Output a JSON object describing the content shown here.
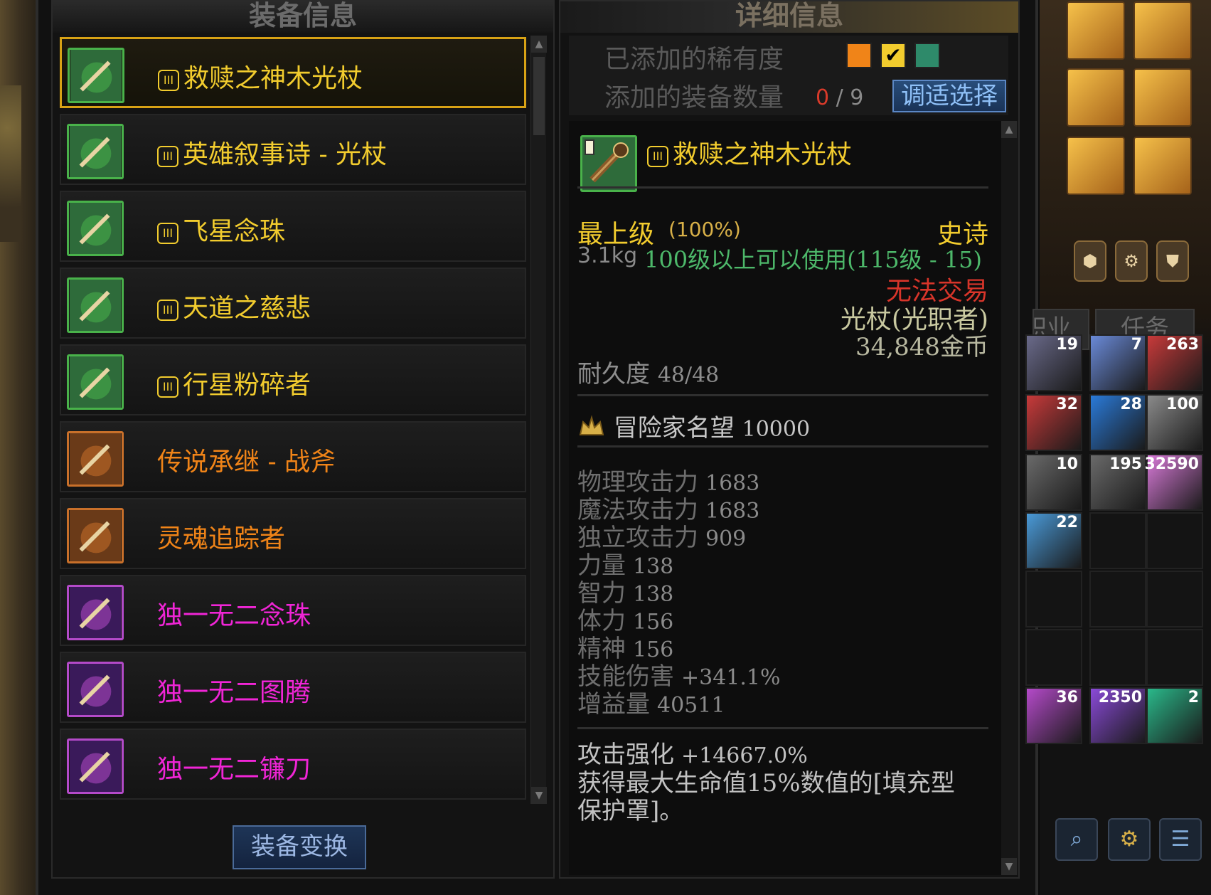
{
  "left_panel": {
    "title": "装备信息",
    "items": [
      {
        "name": "救赎之神木光杖",
        "grade": "epic",
        "roman": "III",
        "selected": true,
        "icon": "staff-icon"
      },
      {
        "name": "英雄叙事诗 - 光杖",
        "grade": "epic",
        "roman": "III",
        "selected": false,
        "icon": "staff-icon"
      },
      {
        "name": "飞星念珠",
        "grade": "epic",
        "roman": "III",
        "selected": false,
        "icon": "rosary-icon"
      },
      {
        "name": "天道之慈悲",
        "grade": "epic",
        "roman": "III",
        "selected": false,
        "icon": "gauntlet-icon"
      },
      {
        "name": "行星粉碎者",
        "grade": "epic",
        "roman": "III",
        "selected": false,
        "icon": "tonfa-icon"
      },
      {
        "name": "传说承继 - 战斧",
        "grade": "legend",
        "roman": "",
        "selected": false,
        "icon": "axe-icon"
      },
      {
        "name": "灵魂追踪者",
        "grade": "legend",
        "roman": "",
        "selected": false,
        "icon": "scythe-icon"
      },
      {
        "name": "独一无二念珠",
        "grade": "unique",
        "roman": "",
        "selected": false,
        "icon": "rosary-icon"
      },
      {
        "name": "独一无二图腾",
        "grade": "unique",
        "roman": "",
        "selected": false,
        "icon": "totem-icon"
      },
      {
        "name": "独一无二镰刀",
        "grade": "unique",
        "roman": "",
        "selected": false,
        "icon": "scythe-icon"
      }
    ],
    "swap_button": "装备变换"
  },
  "right_panel": {
    "title": "详细信息",
    "rarity_label": "已添加的稀有度",
    "count_label": "添加的装备数量",
    "count_current": "0",
    "count_sep": "/",
    "count_max": "9",
    "adjust_button": "调适选择",
    "colors": {
      "legend": "#f08418",
      "epic": "#f2cc2e",
      "unique": "#f025d6",
      "rare_green": "#2e8a6a"
    }
  },
  "detail": {
    "roman": "III",
    "name": "救赎之神木光杖",
    "grade": "最上级",
    "grade_pct": "(100%)",
    "rarity": "史诗",
    "weight": "3.1kg",
    "level_req": "100级以上可以使用(115级 - 15)",
    "trade": "无法交易",
    "type": "光杖(光职者)",
    "price": "34,848金币",
    "durability_label": "耐久度",
    "durability_value": "48/48",
    "fame_label": "冒险家名望",
    "fame_value": "10000",
    "stats": [
      {
        "label": "物理攻击力",
        "value": "1683"
      },
      {
        "label": "魔法攻击力",
        "value": "1683"
      },
      {
        "label": "独立攻击力",
        "value": "909"
      },
      {
        "label": "力量",
        "value": "138"
      },
      {
        "label": "智力",
        "value": "138"
      },
      {
        "label": "体力",
        "value": "156"
      },
      {
        "label": "精神",
        "value": "156"
      },
      {
        "label": "技能伤害",
        "value": "+341.1%"
      },
      {
        "label": "增益量",
        "value": "40511"
      }
    ],
    "attack_label": "攻击强化",
    "attack_value": "+14667.0%",
    "effect_text": "获得最大生命值15%数值的[填充型保护罩]。"
  },
  "side": {
    "tab_1": "职业",
    "tab_2": "任务",
    "inventory_counts": [
      "19",
      "7",
      "263",
      "32",
      "28",
      "100",
      "10",
      "195",
      "32590",
      "22",
      "36",
      "2350",
      "2"
    ]
  }
}
